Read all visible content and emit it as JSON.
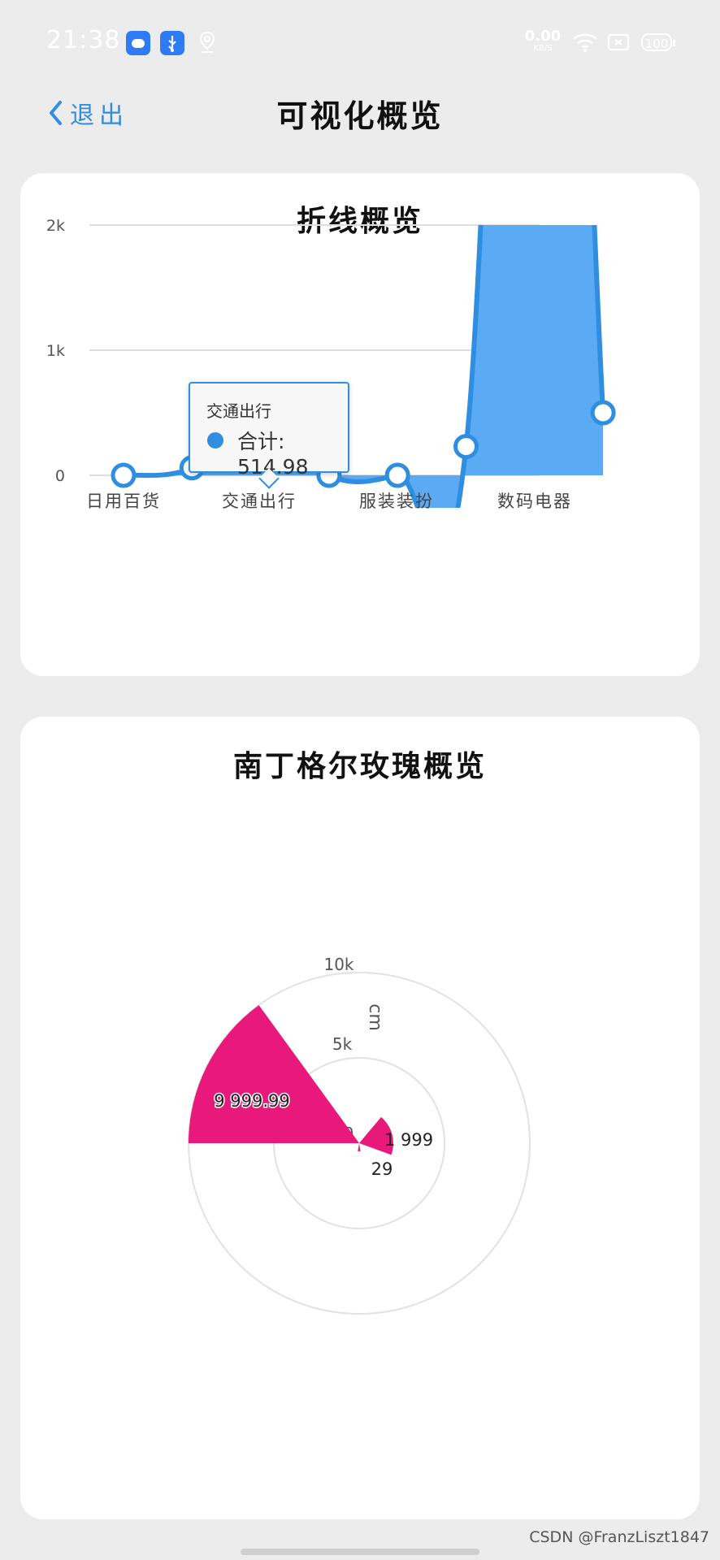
{
  "status_bar": {
    "time": "21:38",
    "speed_value": "0.00",
    "speed_unit": "KB/S",
    "battery": "100"
  },
  "nav": {
    "back_label": "退出",
    "title": "可视化概览"
  },
  "line_card": {
    "title": "折线概览",
    "tooltip": {
      "category": "交通出行",
      "series_label": "合计: 514.98"
    }
  },
  "rose_card": {
    "title": "南丁格尔玫瑰概览"
  },
  "chart_data": [
    {
      "type": "area",
      "title": "折线概览",
      "categories": [
        "日用百货",
        "",
        "交通出行",
        "",
        "服装装扮",
        "",
        "数码电器",
        ""
      ],
      "x_axis_labels": [
        "日用百货",
        "交通出行",
        "服装装扮",
        "数码电器"
      ],
      "series": [
        {
          "name": "合计",
          "values": [
            0,
            60,
            514.98,
            0,
            0,
            230,
            9999.99,
            500
          ]
        }
      ],
      "y_ticks": [
        "0",
        "1k",
        "2k"
      ],
      "ylim": [
        0,
        2000
      ],
      "grid": true,
      "color": "#2f8ee0",
      "fill": "#5aabf4"
    },
    {
      "type": "pie",
      "title": "南丁格尔玫瑰概览",
      "rose": true,
      "radius_unit": "cm",
      "radial_ticks": [
        "0",
        "5k",
        "10k"
      ],
      "radial_max": 10000,
      "slices": [
        {
          "label": "9 999.99",
          "value": 9999.99
        },
        {
          "label": "1 999",
          "value": 1999
        },
        {
          "label": "29",
          "value": 29
        }
      ],
      "color": "#e8197a"
    }
  ],
  "watermark": "CSDN @FranzLiszt1847"
}
